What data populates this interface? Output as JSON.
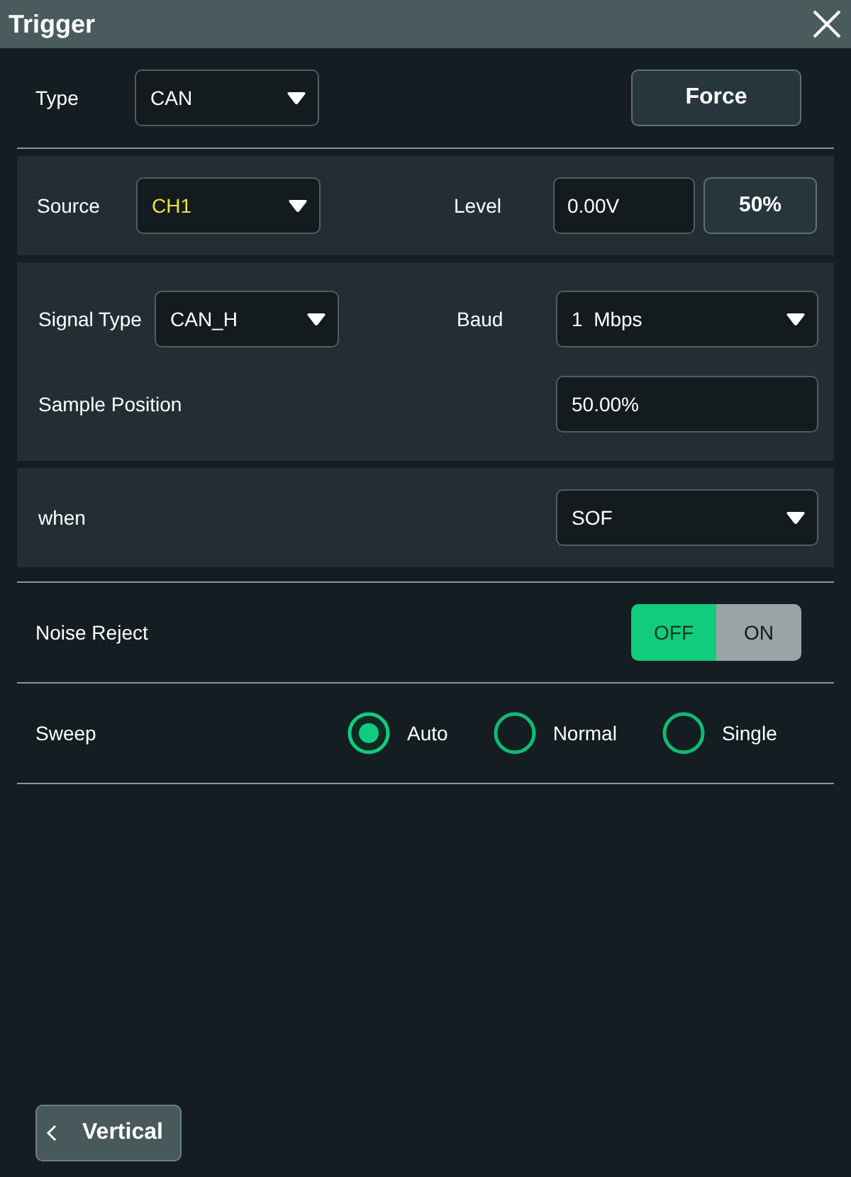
{
  "window": {
    "title": "Trigger"
  },
  "type": {
    "label": "Type",
    "value": "CAN"
  },
  "force_button": "Force",
  "source": {
    "label": "Source",
    "value": "CH1"
  },
  "level": {
    "label": "Level",
    "value": "0.00V",
    "button": "50%"
  },
  "signal_type": {
    "label": "Signal Type",
    "value": "CAN_H"
  },
  "baud": {
    "label": "Baud",
    "value": "1  Mbps"
  },
  "sample_position": {
    "label": "Sample Position",
    "value": "50.00%"
  },
  "when": {
    "label": "when",
    "value": "SOF"
  },
  "noise_reject": {
    "label": "Noise Reject",
    "options": [
      {
        "label": "OFF",
        "selected": true
      },
      {
        "label": "ON",
        "selected": false
      }
    ]
  },
  "sweep": {
    "label": "Sweep",
    "options": [
      {
        "label": "Auto",
        "selected": true
      },
      {
        "label": "Normal",
        "selected": false
      },
      {
        "label": "Single",
        "selected": false
      }
    ]
  },
  "back_button": "Vertical"
}
